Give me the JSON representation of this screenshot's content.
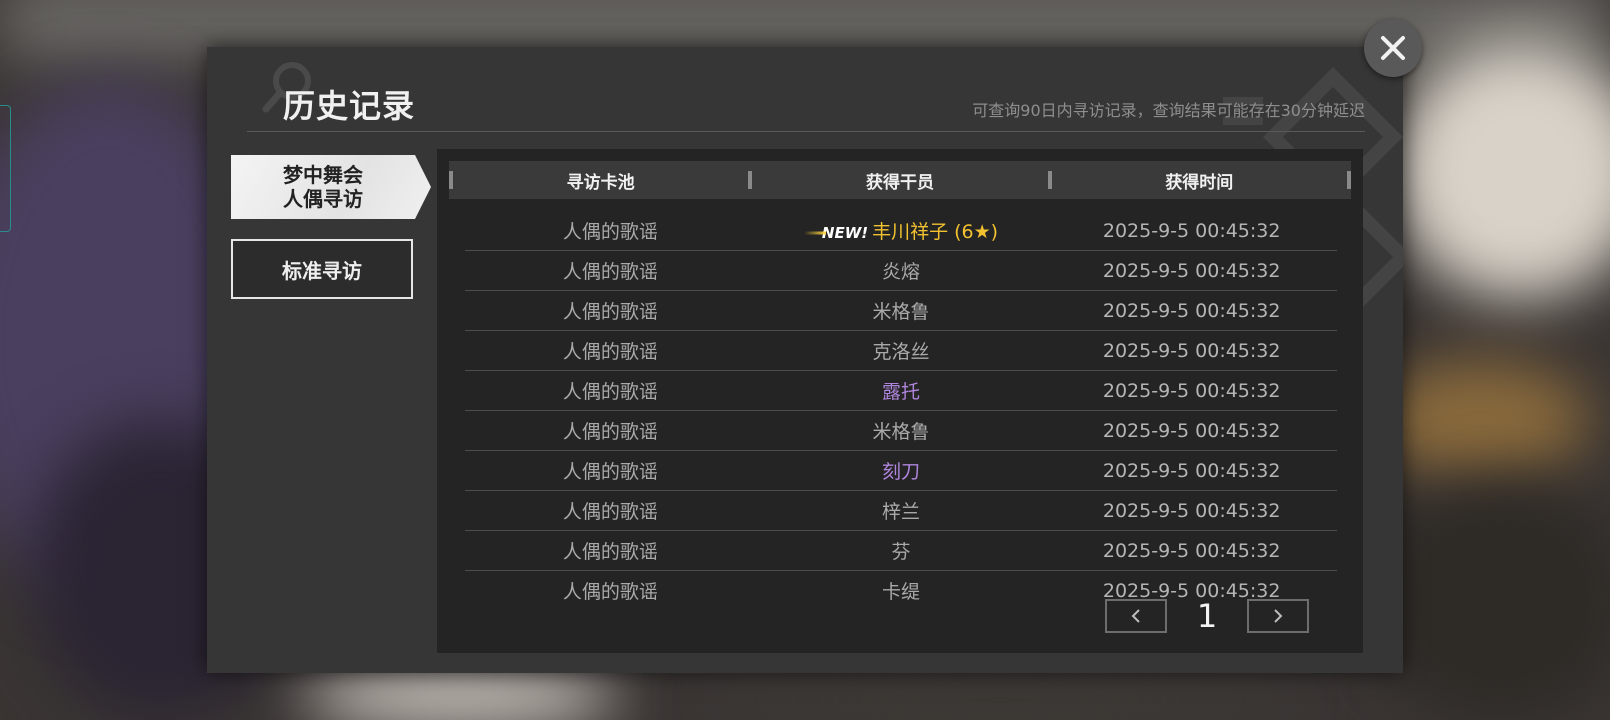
{
  "dialog": {
    "title": "历史记录",
    "subtitle": "可查询90日内寻访记录，查询结果可能存在30分钟延迟"
  },
  "sidebar": {
    "items": [
      {
        "label": "梦中舞会\n人偶寻访",
        "line1": "梦中舞会",
        "line2": "人偶寻访",
        "active": true
      },
      {
        "label": "标准寻访",
        "active": false
      }
    ]
  },
  "table": {
    "headers": [
      "寻访卡池",
      "获得干员",
      "获得时间"
    ],
    "rows": [
      {
        "pool": "人偶的歌谣",
        "operator": "丰川祥子 (6★)",
        "new": "NEW!",
        "rarity": "gold",
        "time": "2025-9-5 00:45:32"
      },
      {
        "pool": "人偶的歌谣",
        "operator": "炎熔",
        "rarity": "normal",
        "time": "2025-9-5 00:45:32"
      },
      {
        "pool": "人偶的歌谣",
        "operator": "米格鲁",
        "rarity": "normal",
        "time": "2025-9-5 00:45:32"
      },
      {
        "pool": "人偶的歌谣",
        "operator": "克洛丝",
        "rarity": "normal",
        "time": "2025-9-5 00:45:32"
      },
      {
        "pool": "人偶的歌谣",
        "operator": "露托",
        "rarity": "purple",
        "time": "2025-9-5 00:45:32"
      },
      {
        "pool": "人偶的歌谣",
        "operator": "米格鲁",
        "rarity": "normal",
        "time": "2025-9-5 00:45:32"
      },
      {
        "pool": "人偶的歌谣",
        "operator": "刻刀",
        "rarity": "purple",
        "time": "2025-9-5 00:45:32"
      },
      {
        "pool": "人偶的歌谣",
        "operator": "梓兰",
        "rarity": "normal",
        "time": "2025-9-5 00:45:32"
      },
      {
        "pool": "人偶的歌谣",
        "operator": "芬",
        "rarity": "normal",
        "time": "2025-9-5 00:45:32"
      },
      {
        "pool": "人偶的歌谣",
        "operator": "卡缇",
        "rarity": "normal",
        "time": "2025-9-5 00:45:32"
      }
    ]
  },
  "pagination": {
    "page": "1",
    "prev_icon": "chevron-left-icon",
    "next_icon": "chevron-right-icon"
  },
  "colors": {
    "gold": "#f2c230",
    "purple": "#b085dd",
    "normal": "#a9a9a9"
  },
  "close_icon": "close-icon"
}
